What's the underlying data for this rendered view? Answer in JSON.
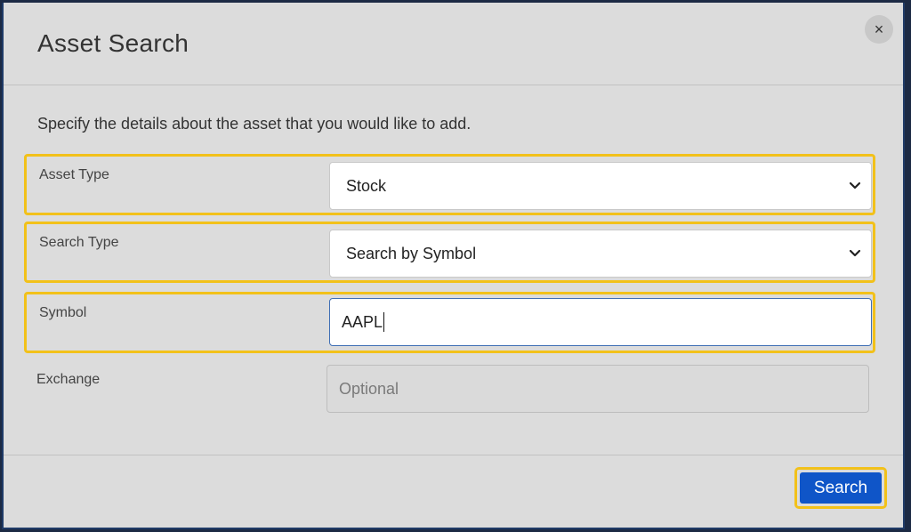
{
  "modal": {
    "title": "Asset Search",
    "close_icon": "×",
    "description": "Specify the details about the asset that you would like to add."
  },
  "fields": {
    "asset_type": {
      "label": "Asset Type",
      "value": "Stock"
    },
    "search_type": {
      "label": "Search Type",
      "value": "Search by Symbol"
    },
    "symbol": {
      "label": "Symbol",
      "value": "AAPL"
    },
    "exchange": {
      "label": "Exchange",
      "placeholder": "Optional"
    }
  },
  "footer": {
    "search_label": "Search"
  },
  "colors": {
    "highlight": "#f2c11a",
    "primary": "#0f55c8",
    "focus": "#3f6fb5"
  }
}
